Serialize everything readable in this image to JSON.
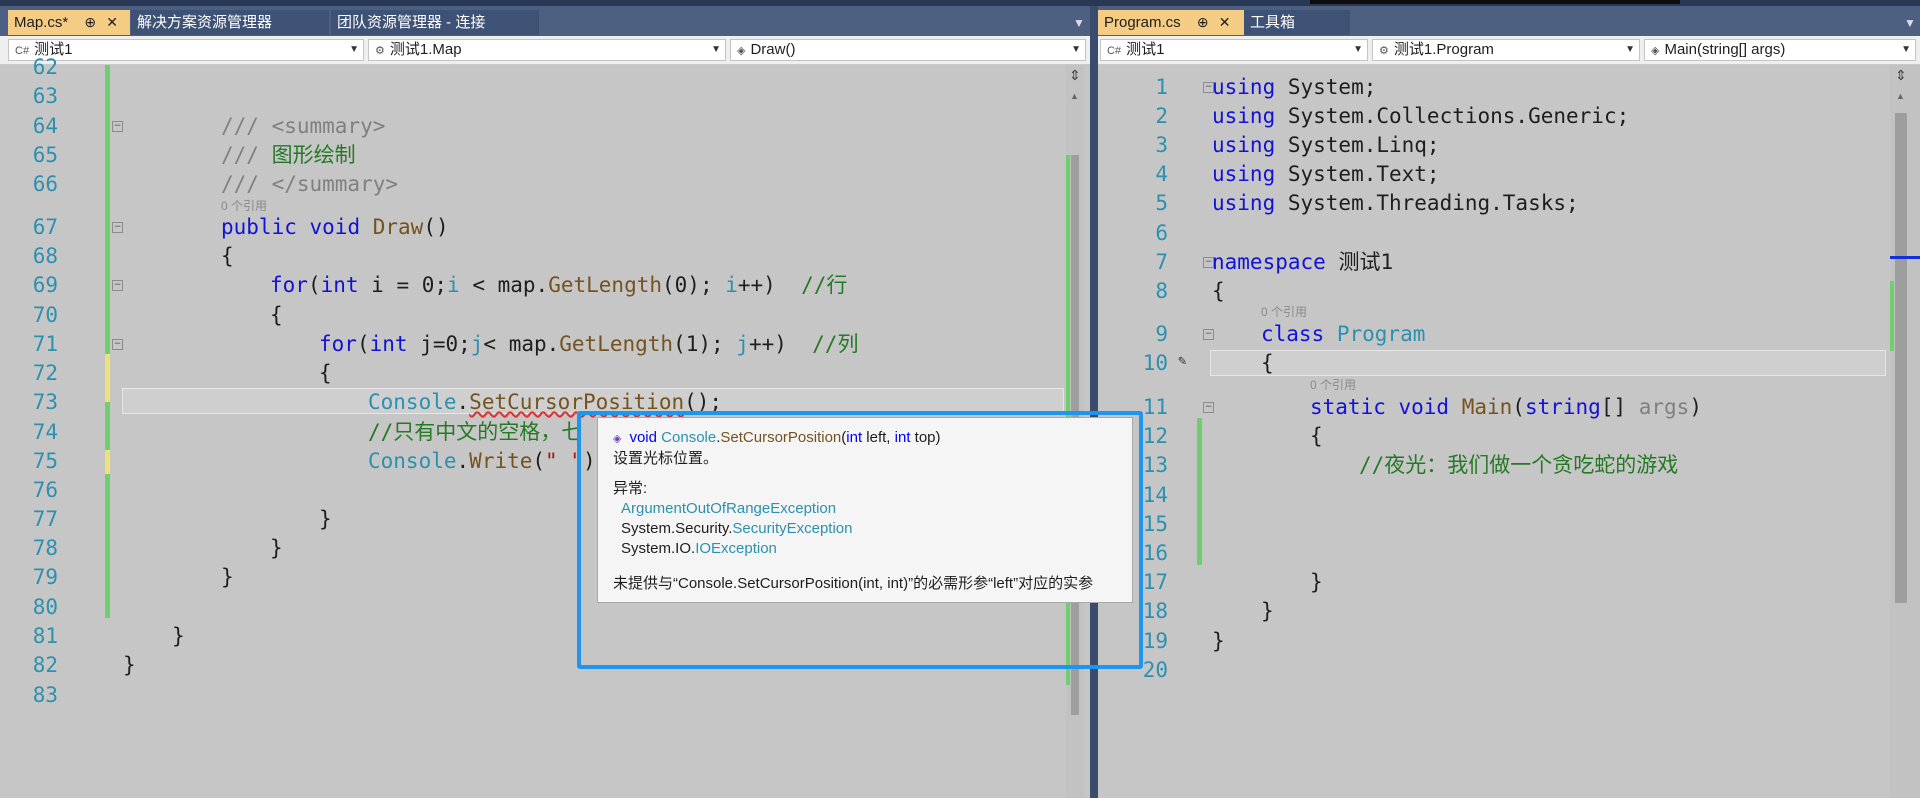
{
  "left": {
    "tabs": [
      {
        "label": "Map.cs*",
        "pin": "⊕",
        "close": "✕"
      },
      {
        "label": "解决方案资源管理器"
      },
      {
        "label": "团队资源管理器 - 连接"
      }
    ],
    "nav": {
      "project": "测试1",
      "class": "测试1.Map",
      "member": "Draw()"
    },
    "codelens": "0 个引用",
    "lines": [
      "62",
      "63",
      "64",
      "65",
      "66",
      "67",
      "68",
      "69",
      "70",
      "71",
      "72",
      "73",
      "74",
      "75",
      "76",
      "77",
      "78",
      "79",
      "80",
      "81",
      "82",
      "83"
    ]
  },
  "right": {
    "tabs": [
      {
        "label": "Program.cs",
        "pin": "⊕",
        "close": "✕"
      },
      {
        "label": "工具箱"
      }
    ],
    "nav": {
      "project": "测试1",
      "class": "测试1.Program",
      "member": "Main(string[] args)"
    },
    "codelens": "0 个引用",
    "lines": [
      "1",
      "2",
      "3",
      "4",
      "5",
      "6",
      "7",
      "8",
      "9",
      "10",
      "11",
      "12",
      "13",
      "14",
      "15",
      "16",
      "17",
      "18",
      "19",
      "20"
    ]
  },
  "code_left": {
    "l64": "/// <summary>",
    "l65_prefix": "/// ",
    "l65_text": "图形绘制",
    "l66": "/// </summary>",
    "l67_kw1": "public",
    "l67_kw2": "void",
    "l67_name": "Draw",
    "l67_rest": "()",
    "l68": "{",
    "l69_for": "for",
    "l69_a": "(",
    "l69_int": "int",
    "l69_b": " i = 0;",
    "l69_i": "i",
    "l69_c": " < map.",
    "l69_m": "GetLength",
    "l69_d": "(0); ",
    "l69_i2": "i",
    "l69_e": "++)  ",
    "l69_cmt": "//行",
    "l70": "{",
    "l71_for": "for",
    "l71_a": "(",
    "l71_int": "int",
    "l71_b": " j=0;",
    "l71_j": "j",
    "l71_c": "< map.",
    "l71_m": "GetLength",
    "l71_d": "(1); ",
    "l71_j2": "j",
    "l71_e": "++)  ",
    "l71_cmt": "//列",
    "l72": "{",
    "l73_type": "Console",
    "l73_dot": ".",
    "l73_m": "SetCursorPosition",
    "l73_rest": "();",
    "l74_cmt": "//只有中文的空格，七",
    "l75_type": "Console",
    "l75_dot": ".",
    "l75_m": "Write",
    "l75_a": "(",
    "l75_str": "\" \"",
    "l75_b": ");",
    "l77": "}",
    "l78": "}",
    "l79": "}",
    "l81": "}",
    "l82": "}"
  },
  "code_right": {
    "using": "using",
    "u1": " System;",
    "u2": " System.Collections.Generic;",
    "u3": " System.Linq;",
    "u4": " System.Text;",
    "u5": " System.Threading.Tasks;",
    "ns_kw": "namespace",
    "ns_name": " 测试1",
    "l8": "{",
    "class_kw": "class",
    "class_name": " Program",
    "l10": "{",
    "static": "static",
    "void": " void",
    "main": " Main",
    "main_a": "(",
    "string": "string",
    "main_b": "[] ",
    "args": "args",
    "main_c": ")",
    "l12": "{",
    "l13_cmt": "//夜光：我们做一个贪吃蛇的游戏",
    "l17": "}",
    "l18": "}",
    "l19": "}"
  },
  "tooltip": {
    "void": "void",
    "console": "Console",
    "dot": ".",
    "method": "SetCursorPosition",
    "open": "(",
    "int1": "int",
    "left": " left, ",
    "int2": "int",
    "top": " top)",
    "desc": "设置光标位置。",
    "exceptions_label": "异常:",
    "ex1": "ArgumentOutOfRangeException",
    "ex2_prefix": "System.Security.",
    "ex2": "SecurityException",
    "ex3_prefix": "System.IO.",
    "ex3": "IOException",
    "error": "未提供与“Console.SetCursorPosition(int, int)”的必需形参“left”对应的实参"
  },
  "colors": {
    "keyword": "#1212d6",
    "comment": "#247a24",
    "type": "#2b91af",
    "method": "#74531f",
    "active_tab": "#f5cc84",
    "highlight_box": "#1e96f0"
  }
}
